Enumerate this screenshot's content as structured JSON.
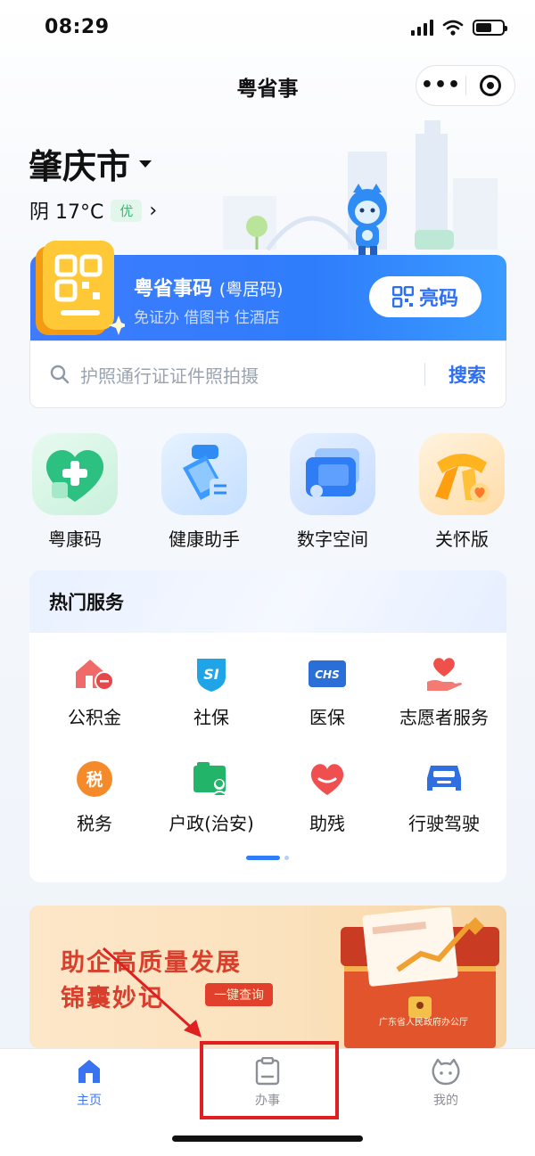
{
  "status": {
    "time": "08:29"
  },
  "header": {
    "title": "粤省事",
    "more_label": "•••"
  },
  "location": {
    "city": "肇庆市",
    "weather": "阴 17°C",
    "air_quality": "优",
    "chevron": "›"
  },
  "code_card": {
    "title": "粤省事码",
    "title_suffix": "(粤居码)",
    "subtitle": "免证办 借图书 住酒店",
    "button_label": "亮码"
  },
  "search": {
    "placeholder": "护照通行证证件照拍摄",
    "button_label": "搜索"
  },
  "quick_tiles": [
    {
      "label": "粤康码",
      "icon": "health-code-heart-icon"
    },
    {
      "label": "健康助手",
      "icon": "health-assistant-icon"
    },
    {
      "label": "数字空间",
      "icon": "digital-space-cards-icon"
    },
    {
      "label": "关怀版",
      "icon": "care-scarf-icon"
    }
  ],
  "hot_services": {
    "title": "热门服务",
    "items": [
      {
        "label": "公积金",
        "icon": "housing-fund-icon"
      },
      {
        "label": "社保",
        "icon": "social-security-si-icon",
        "icon_text": "SI"
      },
      {
        "label": "医保",
        "icon": "medical-insurance-chs-icon",
        "icon_text": "CHS"
      },
      {
        "label": "志愿者服务",
        "icon": "volunteer-heart-hand-icon"
      },
      {
        "label": "税务",
        "icon": "tax-icon",
        "icon_text": "税"
      },
      {
        "label": "户政(治安)",
        "icon": "household-registration-icon"
      },
      {
        "label": "助残",
        "icon": "disability-aid-heart-icon"
      },
      {
        "label": "行驶驾驶",
        "icon": "car-icon"
      }
    ],
    "pager_pages": 2,
    "pager_current": 1
  },
  "banner": {
    "line1": "助企高质量发展",
    "line2": "锦囊妙记",
    "button_label": "一键查询",
    "chest_caption": "广东省人民政府办公厅"
  },
  "tabbar": {
    "tabs": [
      {
        "label": "主页",
        "icon": "home-icon",
        "active": true
      },
      {
        "label": "办事",
        "icon": "clipboard-icon",
        "active": false
      },
      {
        "label": "我的",
        "icon": "profile-icon",
        "active": false
      }
    ]
  },
  "colors": {
    "accent": "#2f7dfb",
    "highlight": "#e02020",
    "banner_text": "#d8402d"
  }
}
